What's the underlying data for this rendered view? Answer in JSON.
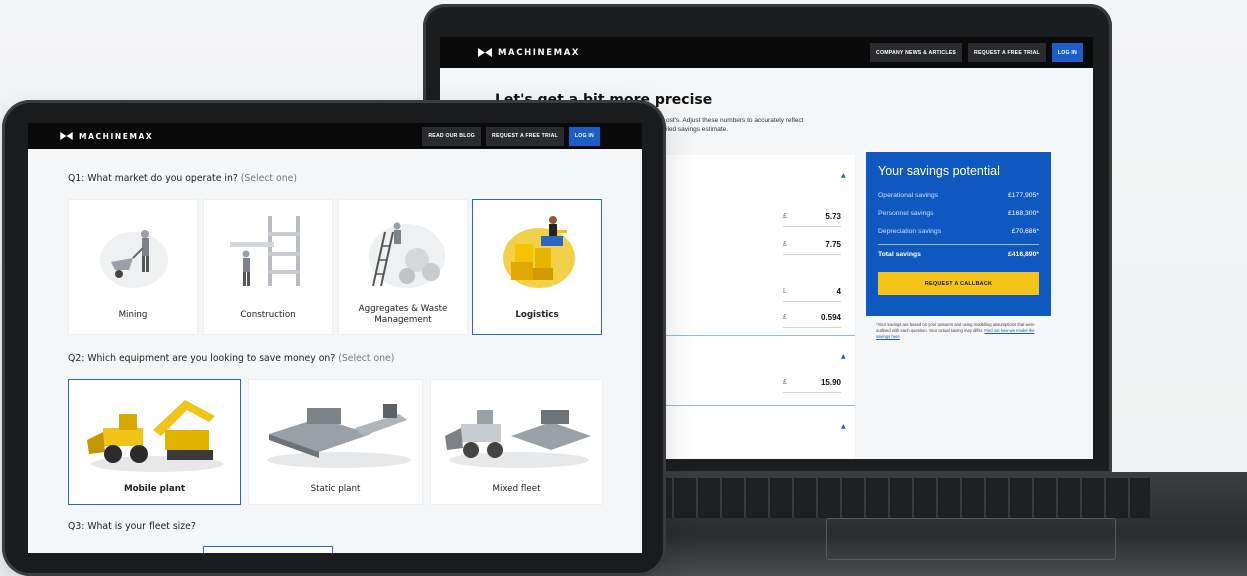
{
  "laptop": {
    "nav": {
      "brand": "MACHINEMAX",
      "buttons": [
        "COMPANY NEWS & ARTICLES",
        "REQUEST A FREE TRIAL",
        "LOG IN"
      ]
    },
    "hero_title": "Let's get a bit more precise",
    "hero_sub_line1": "ost's. Adjust these numbers to accurately reflect",
    "hero_sub_line2": "iled savings estimate.",
    "inputs": [
      {
        "unit": "£",
        "value": "5.73"
      },
      {
        "unit": "£",
        "value": "7.75"
      },
      {
        "unit": "L",
        "value": "4"
      },
      {
        "unit": "£",
        "value": "0.594"
      },
      {
        "unit": "£",
        "value": "15.90"
      }
    ],
    "savings": {
      "title": "Your savings potential",
      "rows": [
        {
          "label": "Operational savings",
          "amount": "£177,905*"
        },
        {
          "label": "Personnel savings",
          "amount": "£168,300*"
        },
        {
          "label": "Depreciation savings",
          "amount": "£70,686*"
        }
      ],
      "total_label": "Total savings",
      "total_amount": "£416,890*",
      "cta": "REQUEST A CALLBACK",
      "note": "*Your savings are based on your answers and using modelling assumptions that were outlined with each question. Your actual saving may differ.",
      "note_link": "Find out how we model the savings here"
    }
  },
  "tablet": {
    "nav": {
      "brand": "MACHINEMAX",
      "buttons": [
        "READ OUR BLOG",
        "REQUEST A FREE TRIAL",
        "LOG IN"
      ]
    },
    "q1": {
      "text": "Q1: What market do you operate in?",
      "hint": "(Select one)"
    },
    "markets": [
      {
        "label": "Mining",
        "selected": false
      },
      {
        "label": "Construction",
        "selected": false
      },
      {
        "label_line1": "Aggregates & Waste",
        "label_line2": "Management",
        "selected": false
      },
      {
        "label": "Logistics",
        "selected": true
      }
    ],
    "q2": {
      "text": "Q2: Which equipment are you looking to save money on?",
      "hint": "(Select one)"
    },
    "equipment": [
      {
        "label": "Mobile plant",
        "selected": true
      },
      {
        "label": "Static plant",
        "selected": false
      },
      {
        "label": "Mixed fleet",
        "selected": false
      }
    ],
    "q3": {
      "text": "Q3: What is your fleet size?"
    }
  },
  "colors": {
    "brand_blue": "#0f58c0",
    "accent_yellow": "#f6c318",
    "nav_black": "#0a0a0a"
  }
}
